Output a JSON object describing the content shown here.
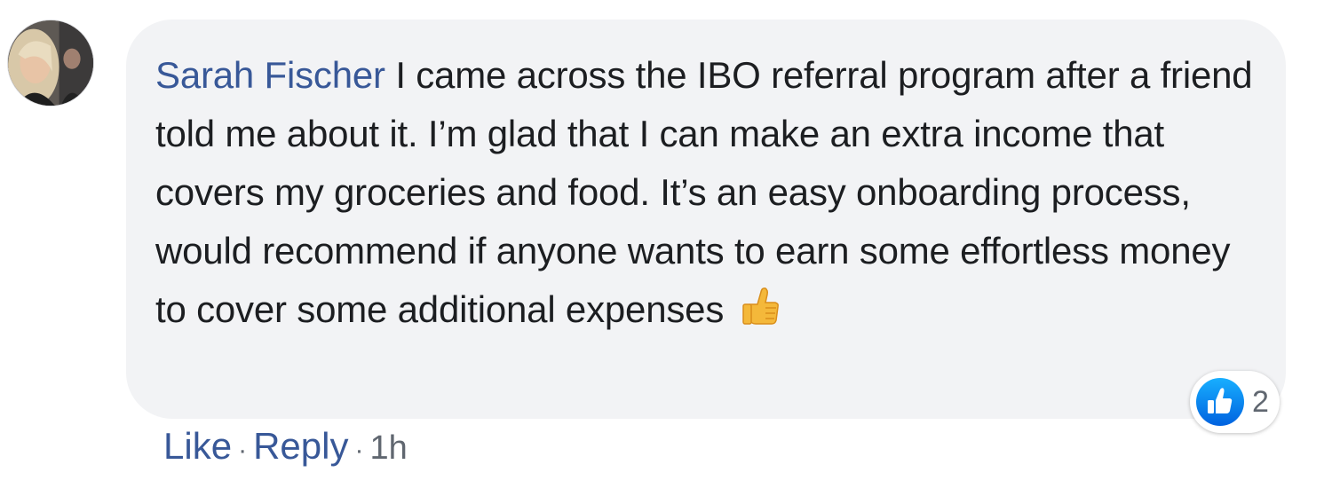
{
  "comment": {
    "author": "Sarah Fischer",
    "text": " I came across the IBO referral program after a friend told me about it. I’m glad that I can make an extra income that covers my groceries and food. It’s an easy onboarding process, would recommend if anyone wants to earn some effortless money to cover some additional expenses ",
    "emoji": "thumbs-up-icon",
    "reaction": {
      "type": "like-reaction-icon",
      "count": "2"
    }
  },
  "actions": {
    "like_label": "Like",
    "separator": "·",
    "reply_label": "Reply",
    "timestamp": "1h"
  },
  "colors": {
    "link": "#385898",
    "bubble": "#f2f3f5",
    "text": "#1c1e21",
    "like_blue": "#1877f2"
  }
}
